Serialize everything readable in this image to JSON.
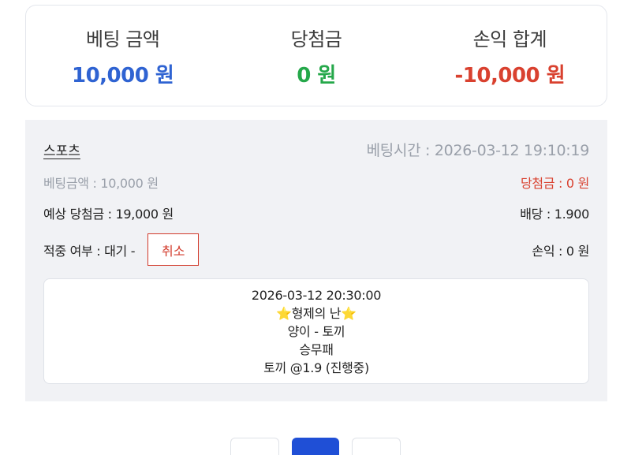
{
  "summary": {
    "bet_amount_label": "베팅 금액",
    "bet_amount_value": "10,000 원",
    "win_amount_label": "당첨금",
    "win_amount_value": "0 원",
    "profit_label": "손익 합계",
    "profit_value": "-10,000 원"
  },
  "bet": {
    "category": "스포츠",
    "bet_time": "베팅시간 : 2026-03-12 19:10:19",
    "bet_amount": "베팅금액 : 10,000 원",
    "win_amount": "당첨금 : 0 원",
    "expected_win": "예상 당첨금 : 19,000 원",
    "odds": "배당 : 1.900",
    "result_status": "적중 여부 : 대기 -",
    "cancel_label": "취소",
    "profit": "손익 : 0 원",
    "match": {
      "datetime": "2026-03-12 20:30:00",
      "star_left": "⭐",
      "league": "형제의 난",
      "star_right": "⭐",
      "teams": "양이 - 토끼",
      "market": "승무패",
      "pick": "토끼 @1.9 (진행중)"
    }
  },
  "pagination": {
    "pages": [
      "",
      "",
      ""
    ],
    "active_index": 1
  },
  "colors": {
    "bet_blue": "#2f63d2",
    "win_green": "#25a84a",
    "loss_red": "#d9412f",
    "active_page": "#1f4fd6"
  }
}
